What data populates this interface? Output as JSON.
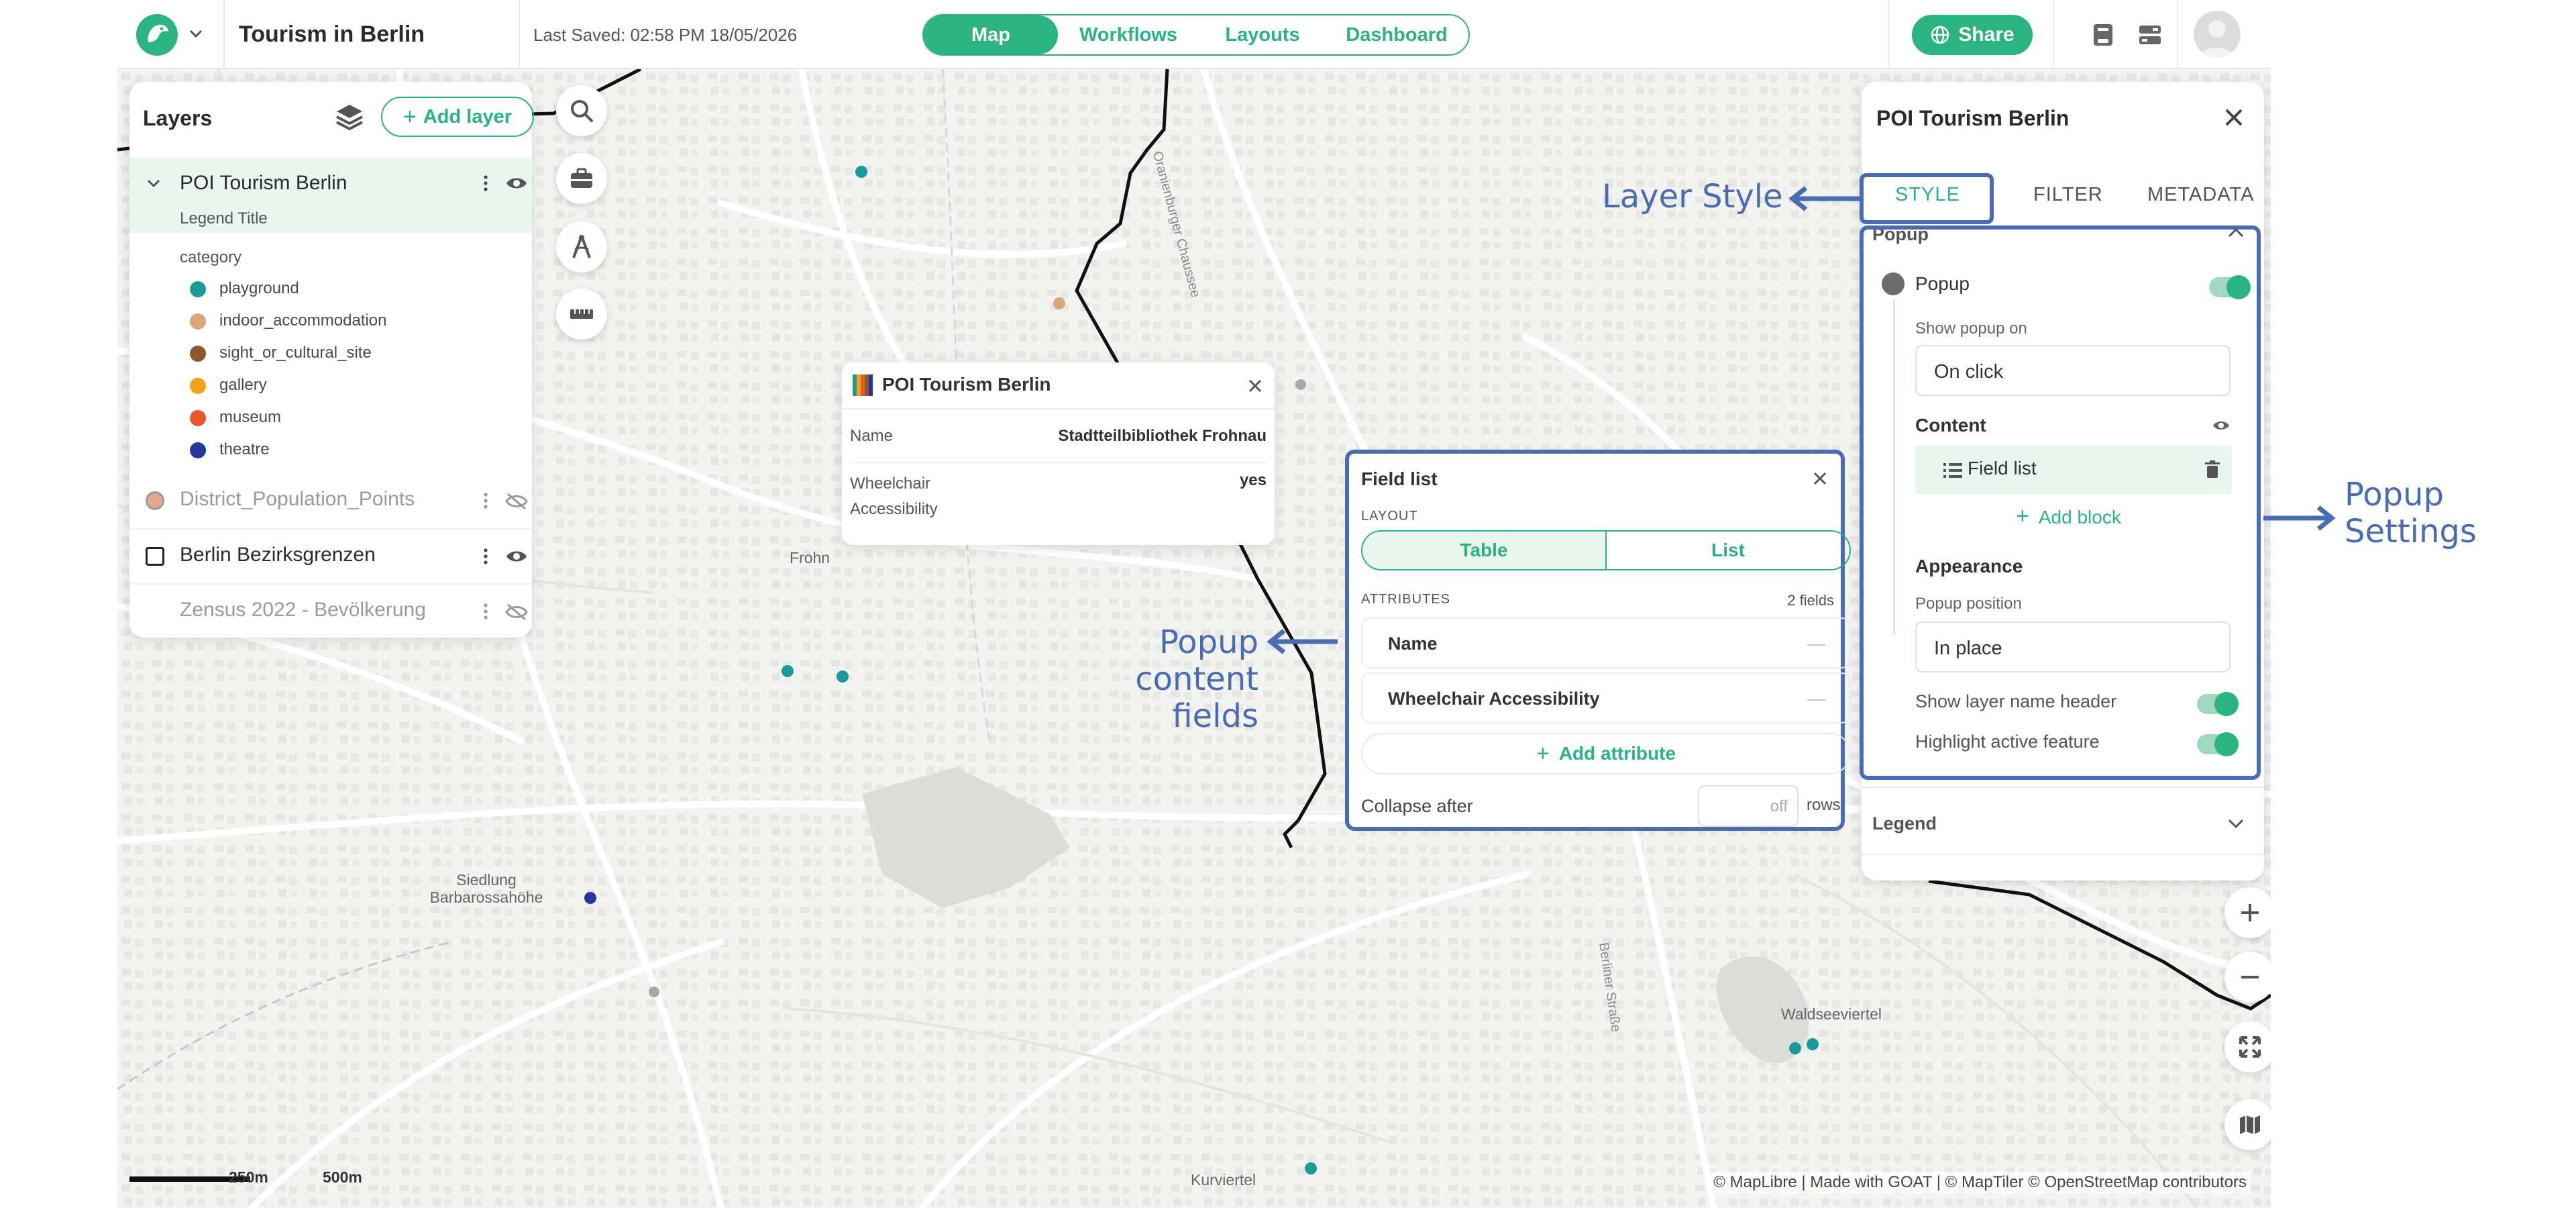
{
  "header": {
    "project_title": "Tourism in Berlin",
    "last_saved": "Last Saved: 02:58 PM 18/05/2026",
    "nav": [
      {
        "label": "Map",
        "active": true
      },
      {
        "label": "Workflows",
        "active": false
      },
      {
        "label": "Layouts",
        "active": false
      },
      {
        "label": "Dashboard",
        "active": false
      }
    ],
    "share_label": "Share",
    "accent_color": "#2bb381"
  },
  "layers_panel": {
    "title": "Layers",
    "add_layer_label": "Add layer",
    "layers": [
      {
        "name": "POI Tourism Berlin",
        "visible": true,
        "expanded": true
      },
      {
        "name": "District_Population_Points",
        "visible": false
      },
      {
        "name": "Berlin Bezirksgrenzen",
        "visible": true
      },
      {
        "name": "Zensus 2022 - Bevölkerung",
        "visible": false
      }
    ],
    "legend_title": "Legend Title",
    "legend_attribute": "category",
    "legend_items": [
      {
        "label": "playground",
        "color": "#1a9a9a"
      },
      {
        "label": "indoor_accommodation",
        "color": "#d9a878"
      },
      {
        "label": "sight_or_cultural_site",
        "color": "#8a5a2b"
      },
      {
        "label": "gallery",
        "color": "#f2a21b"
      },
      {
        "label": "museum",
        "color": "#e8572a"
      },
      {
        "label": "theatre",
        "color": "#23389a"
      }
    ]
  },
  "map_popup": {
    "title": "POI Tourism Berlin",
    "rows": [
      {
        "key": "Name",
        "value": "Stadtteilbibliothek Frohnau"
      },
      {
        "key": "Wheelchair Accessibility",
        "value": "yes"
      }
    ]
  },
  "field_list": {
    "title": "Field list",
    "layout_label": "LAYOUT",
    "layout_options": [
      "Table",
      "List"
    ],
    "layout_selected": "Table",
    "attributes_label": "ATTRIBUTES",
    "attributes_count": "2 fields",
    "attributes": [
      "Name",
      "Wheelchair Accessibility"
    ],
    "dash": "—",
    "add_attribute_label": "Add attribute",
    "collapse_label": "Collapse after",
    "collapse_placeholder": "off",
    "collapse_unit": "rows"
  },
  "settings_panel": {
    "title": "POI Tourism Berlin",
    "tabs": [
      "STYLE",
      "FILTER",
      "METADATA"
    ],
    "active_tab": "STYLE",
    "section_popup": "Popup",
    "popup_toggle_label": "Popup",
    "popup_enabled": true,
    "show_popup_on_label": "Show popup on",
    "show_popup_on_value": "On click",
    "content_label": "Content",
    "content_block": "Field list",
    "add_block_label": "Add block",
    "appearance_label": "Appearance",
    "popup_position_label": "Popup position",
    "popup_position_value": "In place",
    "show_header_label": "Show layer name header",
    "show_header_enabled": true,
    "highlight_label": "Highlight active feature",
    "highlight_enabled": true,
    "section_legend": "Legend"
  },
  "map": {
    "labels": {
      "frohnau": "Frohn",
      "siedlung": "Siedlung\nBarbarossahöhe",
      "waldseeviertel": "Waldseeviertel",
      "kurviertel": "Kurviertel",
      "road1": "Oranienburger Chaussee",
      "road2": "Berliner Straße"
    },
    "scale_labels": [
      "250m",
      "500m"
    ],
    "attribution": "© MapLibre | Made with GOAT | © MapTiler © OpenStreetMap contributors"
  },
  "annotations": {
    "layer_style": "Layer Style",
    "popup_settings": "Popup\nSettings",
    "popup_content_fields": "Popup content\nfields",
    "color": "#4a6cb3"
  }
}
